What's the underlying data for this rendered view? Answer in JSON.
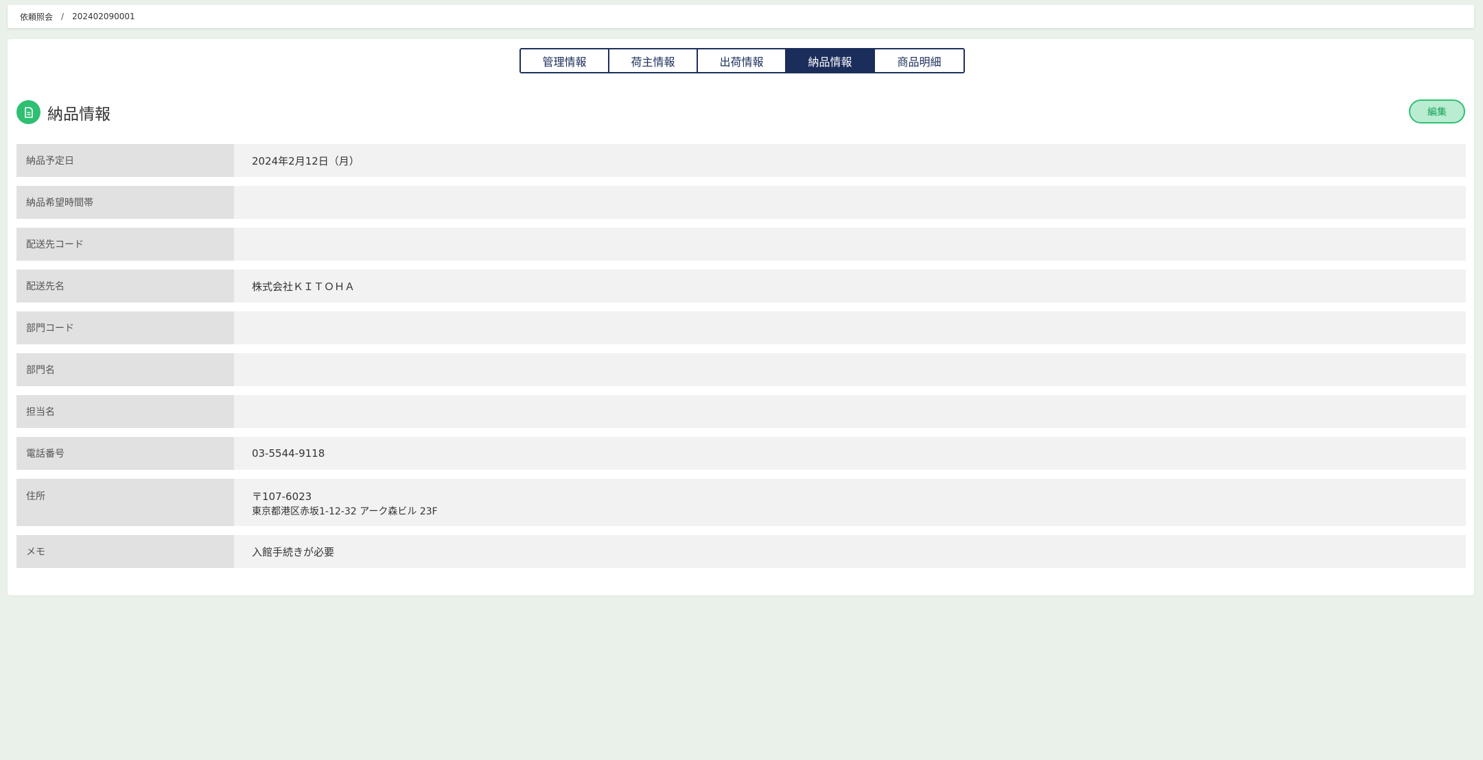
{
  "breadcrumb": {
    "parent": "依頼照会",
    "separator": "/",
    "current": "202402090001"
  },
  "tabs": [
    {
      "label": "管理情報",
      "active": false
    },
    {
      "label": "荷主情報",
      "active": false
    },
    {
      "label": "出荷情報",
      "active": false
    },
    {
      "label": "納品情報",
      "active": true
    },
    {
      "label": "商品明細",
      "active": false
    }
  ],
  "section": {
    "title": "納品情報",
    "icon": "document-icon",
    "edit_label": "編集"
  },
  "fields": [
    {
      "label": "納品予定日",
      "value": "2024年2月12日（月）"
    },
    {
      "label": "納品希望時間帯",
      "value": ""
    },
    {
      "label": "配送先コード",
      "value": ""
    },
    {
      "label": "配送先名",
      "value": "株式会社ＫＩＴＯＨＡ"
    },
    {
      "label": "部門コード",
      "value": ""
    },
    {
      "label": "部門名",
      "value": ""
    },
    {
      "label": "担当名",
      "value": ""
    },
    {
      "label": "電話番号",
      "value": "03-5544-9118"
    },
    {
      "label": "住所",
      "value_line1": "〒107-6023",
      "value_line2": "東京都港区赤坂1-12-32 アーク森ビル 23F"
    },
    {
      "label": "メモ",
      "value": "入館手続きが必要"
    }
  ],
  "colors": {
    "navy": "#1b2d5b",
    "green": "#2fbf72",
    "background": "#e9f1ea"
  }
}
